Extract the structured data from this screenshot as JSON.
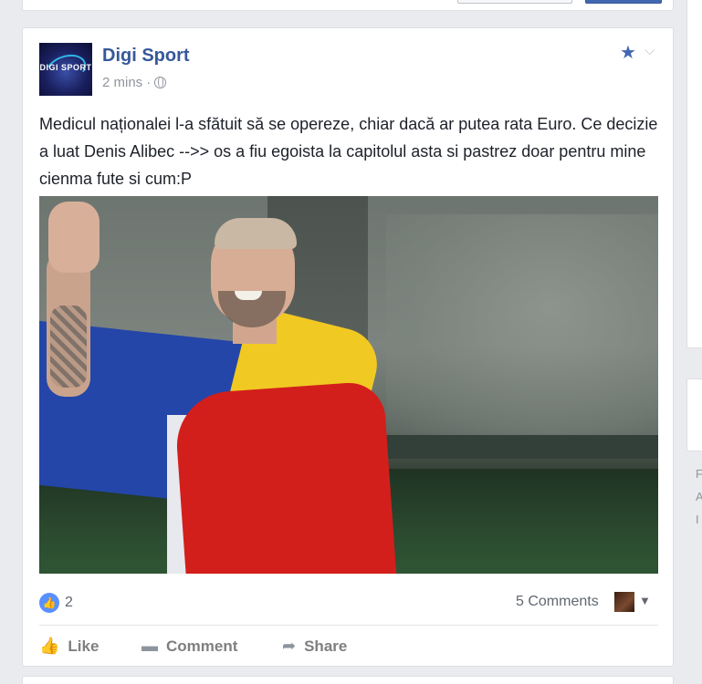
{
  "post": {
    "page_name": "Digi Sport",
    "avatar_text": "DIGI SPORT",
    "timestamp": "2 mins",
    "separator": "·",
    "privacy_icon": "globe-icon",
    "text": "Medicul naționalei l-a sfătuit să se opereze, chiar dacă ar putea rata Euro. Ce decizie a luat Denis Alibec -->> os a fiu egoista la capitolul asta si pastrez doar pentru mine cienma fute si cum:P"
  },
  "footer": {
    "like_count": "2",
    "comments": "5 Comments",
    "like_label": "Like",
    "comment_label": "Comment",
    "share_label": "Share"
  },
  "right_fragments": [
    "F",
    "A",
    "I"
  ],
  "colors": {
    "link_blue": "#365899",
    "accent_blue": "#4267b2",
    "meta_gray": "#90949c",
    "background": "#e9ebee"
  }
}
